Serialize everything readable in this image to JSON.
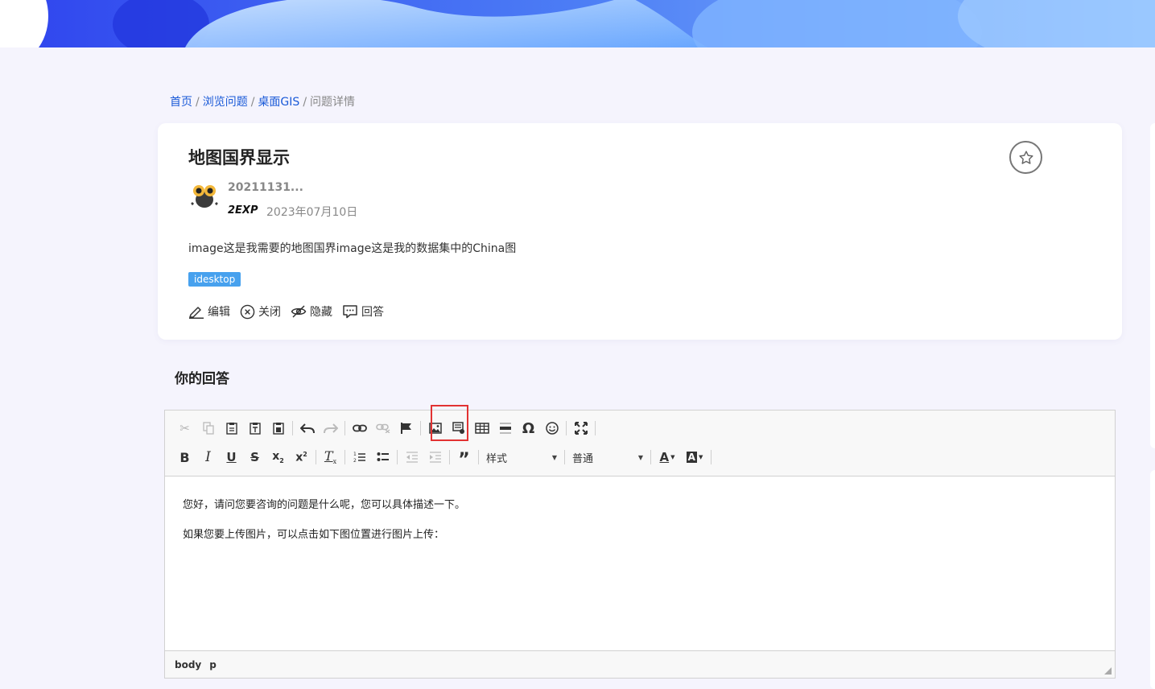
{
  "breadcrumb": {
    "items": [
      "首页",
      "浏览问题",
      "桌面GIS"
    ],
    "current": "问题详情",
    "separator": "/"
  },
  "question": {
    "title": "地图国界显示",
    "author": "20211131...",
    "level": "2EXP",
    "date": "2023年07月10日",
    "body": "image这是我需要的地图国界image这是我的数据集中的China图",
    "tag": "idesktop",
    "actions": {
      "edit": "编辑",
      "close": "关闭",
      "hide": "隐藏",
      "answer": "回答"
    }
  },
  "answer": {
    "heading": "你的回答"
  },
  "editor": {
    "style_combo": "样式",
    "format_combo": "普通",
    "content": [
      "您好，请问您要咨询的问题是什么呢，您可以具体描述一下。",
      "如果您要上传图片，可以点击如下图位置进行图片上传："
    ],
    "status_path": [
      "body",
      "p"
    ]
  },
  "colors": {
    "link": "#1a5ad8",
    "tag_bg": "#47a1ee",
    "highlight": "#e23232",
    "page_bg": "#f5f4fd"
  }
}
